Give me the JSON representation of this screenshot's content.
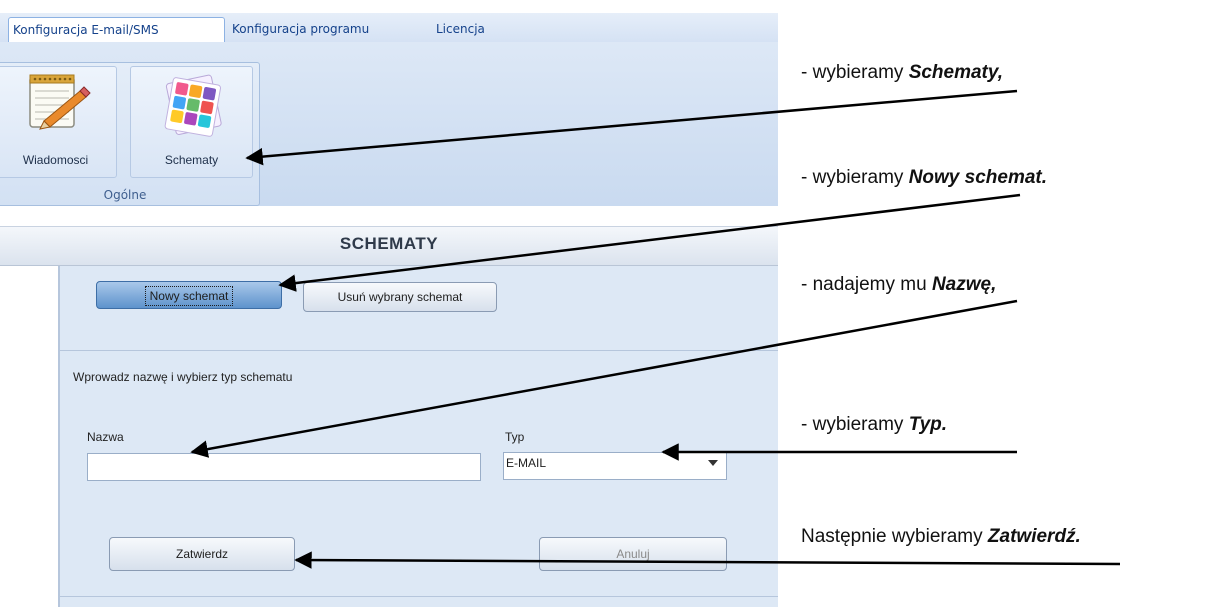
{
  "tabs": [
    {
      "label": "Konfiguracja E-mail/SMS",
      "active": true
    },
    {
      "label": "Konfiguracja programu",
      "active": false
    },
    {
      "label": "Licencja",
      "active": false
    }
  ],
  "ribbon": {
    "group_label": "Ogólne",
    "buttons": [
      {
        "label": "Wiadomosci",
        "icon": "notepad-pencil-icon"
      },
      {
        "label": "Schematy",
        "icon": "colorful-tiles-icon"
      }
    ]
  },
  "header": {
    "title": "SCHEMATY"
  },
  "toolbar": {
    "new_label": "Nowy schemat",
    "delete_label": "Usuń wybrany schemat"
  },
  "form": {
    "prompt": "Wprowadz nazwę i wybierz typ schematu",
    "name_label": "Nazwa",
    "name_value": "",
    "type_label": "Typ",
    "type_value": "E-MAIL",
    "confirm_label": "Zatwierdz",
    "cancel_label": "Anuluj"
  },
  "annotations": [
    {
      "prefix": "- wybieramy ",
      "emph": "Schematy,"
    },
    {
      "prefix": "- wybieramy  ",
      "emph": "Nowy schemat."
    },
    {
      "prefix": "- nadajemy mu ",
      "emph": "Nazwę,"
    },
    {
      "prefix": "- wybieramy ",
      "emph": "Typ."
    },
    {
      "prefix": "Następnie  wybieramy  ",
      "emph": "Zatwierdź."
    }
  ],
  "colors": {
    "ribbon": "#d3e1f3",
    "panel": "#dde8f5",
    "tab_text": "#15428b",
    "pressed_button": "#5e93cc"
  }
}
